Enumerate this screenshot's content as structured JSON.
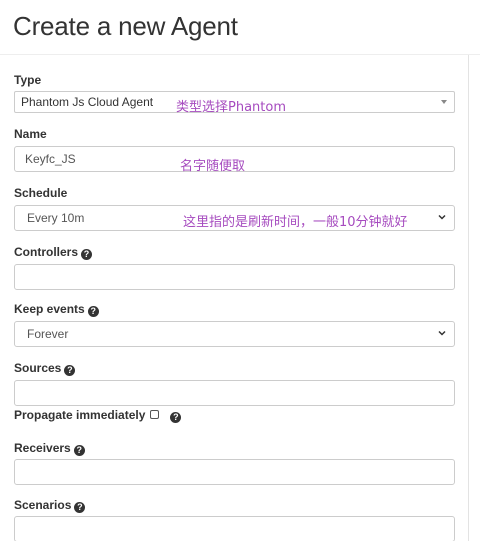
{
  "page": {
    "title": "Create a new Agent"
  },
  "type": {
    "label": "Type",
    "selected": "Phantom Js Cloud Agent",
    "annotation": "类型选择Phantom"
  },
  "name": {
    "label": "Name",
    "value": "Keyfc_JS",
    "annotation": "名字随便取"
  },
  "schedule": {
    "label": "Schedule",
    "selected": "Every 10m",
    "annotation": "这里指的是刷新时间，一般10分钟就好"
  },
  "controllers": {
    "label": "Controllers",
    "value": ""
  },
  "keep_events": {
    "label": "Keep events",
    "selected": "Forever"
  },
  "sources": {
    "label": "Sources",
    "value": ""
  },
  "propagate": {
    "label": "Propagate immediately",
    "checked": false
  },
  "receivers": {
    "label": "Receivers",
    "value": ""
  },
  "scenarios": {
    "label": "Scenarios",
    "value": ""
  },
  "icons": {
    "help": "question-circle-icon",
    "dropdown": "chevron-down-icon"
  },
  "colors": {
    "annotation": "#a64bbf",
    "border": "#cccccc",
    "text": "#333333"
  }
}
